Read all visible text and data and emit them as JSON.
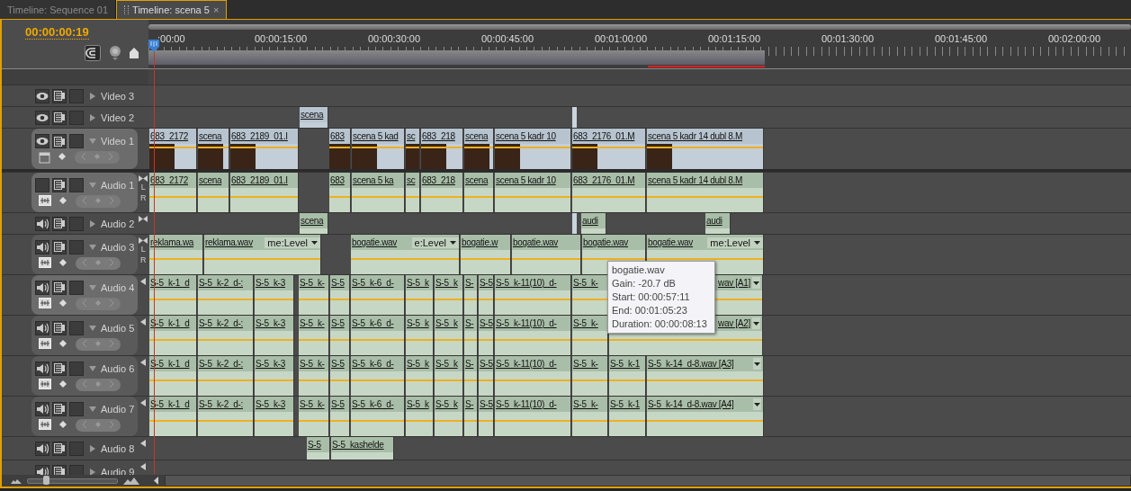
{
  "tabs": [
    {
      "label": "Timeline: Sequence 01",
      "selected": false
    },
    {
      "label": "Timeline: scena 5",
      "selected": true,
      "close": "×"
    }
  ],
  "timecode": "00:00:00:19",
  "ruler": {
    "labels": [
      ":00:00",
      "00:00:15:00",
      "00:00:30:00",
      "00:00:45:00",
      "00:01:00:00",
      "00:01:15:00",
      "00:01:30:00",
      "00:01:45:00",
      "00:02:00:00"
    ]
  },
  "tracks": [
    {
      "kind": "video",
      "name": "Video 3",
      "expanded": false,
      "visible": true,
      "targeted": false
    },
    {
      "kind": "video",
      "name": "Video 2",
      "expanded": false,
      "visible": true,
      "targeted": false,
      "clips": [
        {
          "kind": "clip",
          "label": "scena"
        },
        {
          "kind": "sliver"
        }
      ]
    },
    {
      "kind": "video",
      "name": "Video 1",
      "expanded": true,
      "visible": true,
      "targeted": true,
      "clips": [
        {
          "label": "683_2172"
        },
        {
          "label": "scena"
        },
        {
          "label": "683_2189_01.I"
        },
        {
          "label": "683"
        },
        {
          "label": "scena 5 kad"
        },
        {
          "label": "sc"
        },
        {
          "label": "683_218"
        },
        {
          "label": "scena"
        },
        {
          "label": "scena 5 kadr 10"
        },
        {
          "label": "683_2176_01.M"
        },
        {
          "label": "scena 5 kadr 14 dubl 8.M"
        }
      ]
    },
    {
      "kind": "audio",
      "name": "Audio 1",
      "expanded": true,
      "audible": false,
      "targeted": true,
      "channels": [
        "L",
        "R"
      ],
      "clips": [
        {
          "label": "683_2172"
        },
        {
          "label": "scena"
        },
        {
          "label": "683_2189_01.I"
        },
        {
          "label": "683"
        },
        {
          "label": "scena 5 ka"
        },
        {
          "label": "sc"
        },
        {
          "label": "683_218"
        },
        {
          "label": "scena"
        },
        {
          "label": "scena 5 kadr 10"
        },
        {
          "label": "683_2176_01.M"
        },
        {
          "label": "scena 5 kadr 14 dubl 8.M"
        }
      ]
    },
    {
      "kind": "audio",
      "name": "Audio 2",
      "expanded": false,
      "audible": true,
      "targeted": false,
      "clips": [
        {
          "kind": "clip",
          "label": "scena"
        },
        {
          "kind": "sliver"
        },
        {
          "kind": "clip",
          "label": "audi"
        },
        {
          "kind": "clip",
          "label": "audi"
        }
      ]
    },
    {
      "kind": "audio",
      "name": "Audio 3",
      "expanded": true,
      "audible": true,
      "targeted": false,
      "channels": [
        "L",
        "R"
      ],
      "clips": [
        {
          "label": "reklama.wa"
        },
        {
          "label": "reklama.wav",
          "effect": "me:Level"
        },
        {
          "label": "bogatie.wav",
          "effect": "e:Level"
        },
        {
          "label": "bogatie.w"
        },
        {
          "label": "bogatie.wav"
        },
        {
          "label": "bogatie.wav"
        },
        {
          "label": "bogatie.wav",
          "effect": "me:Level"
        }
      ]
    },
    {
      "kind": "audio",
      "name": "Audio 4",
      "expanded": true,
      "audible": true,
      "targeted": true,
      "clips": [
        {
          "label": "S-5_k-1_d"
        },
        {
          "label": "S-5_k-2_d-:"
        },
        {
          "label": "S-5_k-3"
        },
        {
          "label": "S-5_k-"
        },
        {
          "label": "S-5"
        },
        {
          "label": "S-5_k-6_d-"
        },
        {
          "label": "S-5_k"
        },
        {
          "label": "S-5_k"
        },
        {
          "label": "S-"
        },
        {
          "label": "S-5"
        },
        {
          "label": "S-5_k-11(10)_d-"
        },
        {
          "label": "S-5_k-"
        },
        {
          "label": "wav [A1]",
          "menu": true
        }
      ]
    },
    {
      "kind": "audio",
      "name": "Audio 5",
      "expanded": true,
      "audible": true,
      "targeted": false,
      "clips": [
        {
          "label": "S-5_k-1_d"
        },
        {
          "label": "S-5_k-2_d-:"
        },
        {
          "label": "S-5_k-3"
        },
        {
          "label": "S-5_k-"
        },
        {
          "label": "S-5"
        },
        {
          "label": "S-5_k-6_d-"
        },
        {
          "label": "S-5_k"
        },
        {
          "label": "S-5_k"
        },
        {
          "label": "S-"
        },
        {
          "label": "S-5"
        },
        {
          "label": "S-5_k-11(10)_d-"
        },
        {
          "label": "S-5_k-"
        },
        {
          "label": "wav [A2]",
          "menu": true
        }
      ]
    },
    {
      "kind": "audio",
      "name": "Audio 6",
      "expanded": true,
      "audible": true,
      "targeted": false,
      "clips": [
        {
          "label": "S-5_k-1_d"
        },
        {
          "label": "S-5_k-2_d-:"
        },
        {
          "label": "S-5_k-3"
        },
        {
          "label": "S-5_k-"
        },
        {
          "label": "S-5"
        },
        {
          "label": "S-5_k-6_d-"
        },
        {
          "label": "S-5_k"
        },
        {
          "label": "S-5_k"
        },
        {
          "label": "S-"
        },
        {
          "label": "S-5"
        },
        {
          "label": "S-5_k-11(10)_d-"
        },
        {
          "label": "S-5_k-"
        },
        {
          "label": "S-5_k-1"
        },
        {
          "label": "S-5_k-14_d-8.wav [A3]",
          "menu": true
        }
      ]
    },
    {
      "kind": "audio",
      "name": "Audio 7",
      "expanded": true,
      "audible": true,
      "targeted": false,
      "clips": [
        {
          "label": "S-5_k-1_d"
        },
        {
          "label": "S-5_k-2_d-:"
        },
        {
          "label": "S-5_k-3"
        },
        {
          "label": "S-5_k-"
        },
        {
          "label": "S-5"
        },
        {
          "label": "S-5_k-6_d-"
        },
        {
          "label": "S-5_k"
        },
        {
          "label": "S-5_k"
        },
        {
          "label": "S-"
        },
        {
          "label": "S-5"
        },
        {
          "label": "S-5_k-11(10)_d-"
        },
        {
          "label": "S-5_k-"
        },
        {
          "label": "S-5_k-1"
        },
        {
          "label": "S-5_k-14_d-8.wav [A4]",
          "menu": true
        }
      ]
    },
    {
      "kind": "audio",
      "name": "Audio 8",
      "expanded": false,
      "audible": true,
      "targeted": false,
      "clips": [
        {
          "label": "S-5"
        },
        {
          "label": "S-5_kashelde"
        }
      ]
    },
    {
      "kind": "audio",
      "name": "Audio 9",
      "expanded": false,
      "audible": true,
      "targeted": false
    }
  ],
  "tooltip": {
    "lines": [
      "bogatie.wav",
      "Gain: -20.7 dB",
      "Start: 00:00:57:11",
      "End: 00:01:05:23",
      "Duration: 00:00:08:13"
    ]
  },
  "zoom": {
    "level": 0.2
  }
}
